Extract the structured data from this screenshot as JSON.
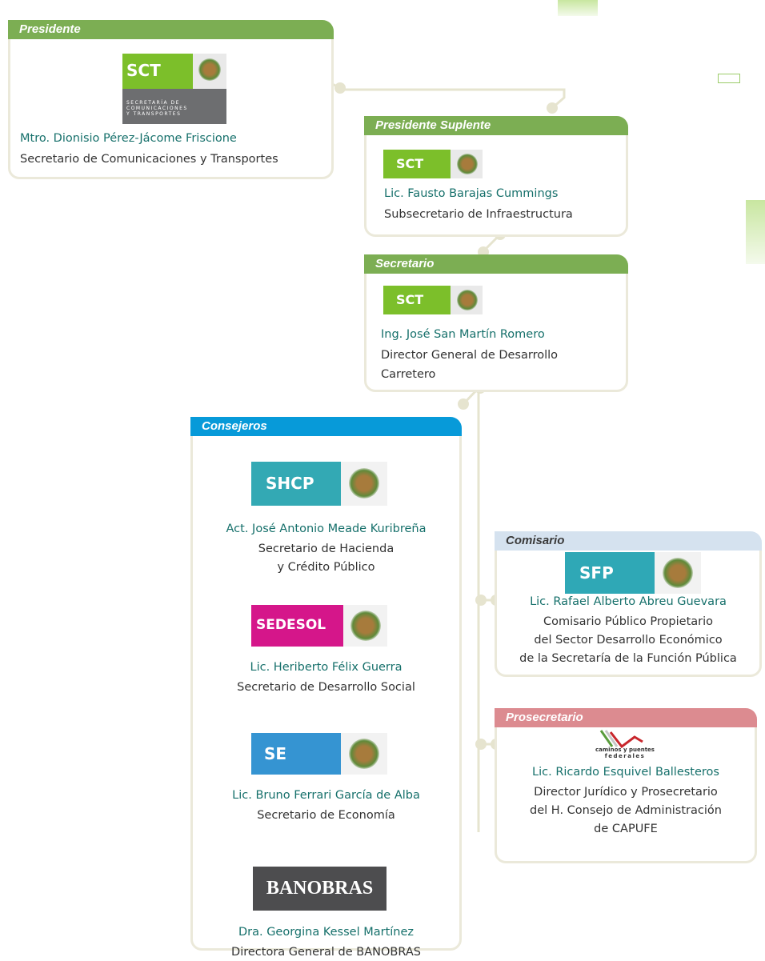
{
  "presidente": {
    "header": "Presidente",
    "logo_text": "SCT",
    "logo_subtext": [
      "SECRETARÍA DE",
      "COMUNICACIONES",
      "Y TRANSPORTES"
    ],
    "name": "Mtro. Dionisio Pérez-Jácome Friscione",
    "role": "Secretario de Comunicaciones y Transportes"
  },
  "suplente": {
    "header": "Presidente Suplente",
    "logo_text": "SCT",
    "name": "Lic. Fausto Barajas Cummings",
    "role": "Subsecretario de Infraestructura"
  },
  "secretario": {
    "header": "Secretario",
    "logo_text": "SCT",
    "name": "Ing. José San Martín Romero",
    "role_lines": [
      "Director General de Desarrollo",
      "Carretero"
    ]
  },
  "consejeros": {
    "header": "Consejeros",
    "members": [
      {
        "logo_text": "SHCP",
        "name": "Act. José Antonio Meade Kuribreña",
        "role_lines": [
          "Secretario de  Hacienda",
          "y Crédito  Público"
        ]
      },
      {
        "logo_text": "SEDESOL",
        "name": "Lic. Heriberto Félix Guerra",
        "role_lines": [
          "Secretario de  Desarrollo Social"
        ]
      },
      {
        "logo_text": "SE",
        "name": "Lic. Bruno Ferrari García de Alba",
        "role_lines": [
          "Secretario de Economía"
        ]
      },
      {
        "logo_text": "BANOBRAS",
        "name": "Dra. Georgina Kessel Martínez",
        "role_lines": [
          "Directora General  de BANOBRAS"
        ]
      }
    ]
  },
  "comisario": {
    "header": "Comisario",
    "logo_text": "SFP",
    "name": "Lic. Rafael Alberto Abreu Guevara",
    "role_lines": [
      "Comisario Público Propietario",
      "del Sector Desarrollo Económico",
      "de la Secretaría de la Función Pública"
    ]
  },
  "prosecretario": {
    "header": "Prosecretario",
    "logo_lines": [
      "caminos y puentes",
      "federales"
    ],
    "name": "Lic. Ricardo Esquivel Ballesteros",
    "role_lines": [
      "Director Jurídico y Prosecretario",
      "del H. Consejo de Administración",
      "de CAPUFE"
    ]
  },
  "colors": {
    "green": "#7cae53",
    "blue": "#079ad9",
    "light_blue": "#d5e2ef",
    "pink": "#dc8b90",
    "name_text": "#16706b",
    "border": "#ebe9da",
    "connector": "#e6e4cf"
  }
}
